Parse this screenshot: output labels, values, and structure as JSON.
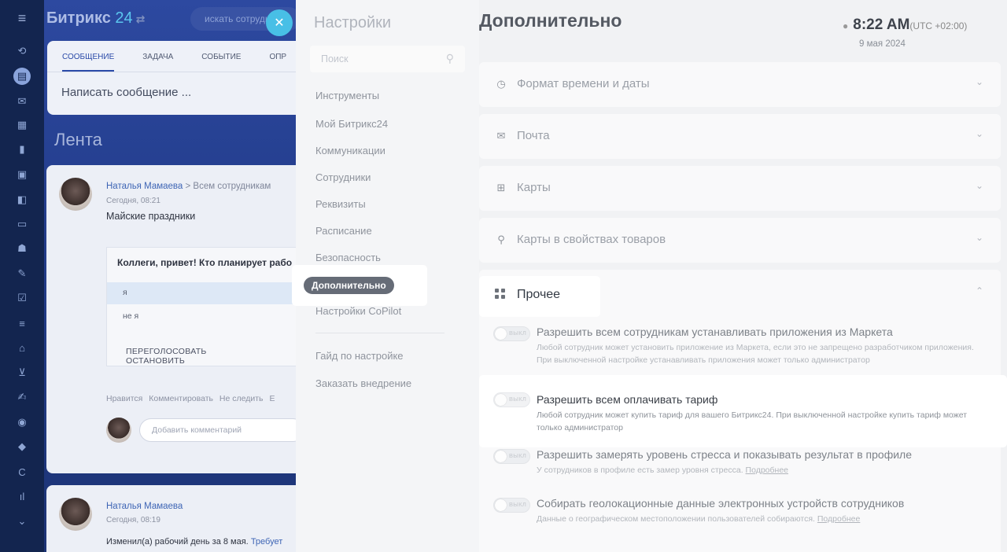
{
  "leftbar": {
    "icons": [
      "menu-icon",
      "feed-icon",
      "chat-icon",
      "mail-icon",
      "calendar-icon",
      "document-icon",
      "contacts-icon",
      "messenger-icon",
      "storage-icon",
      "team-icon",
      "tasks-icon",
      "checklist-icon",
      "filter-icon",
      "store-icon",
      "cart-icon",
      "sign-icon",
      "robot-icon",
      "box-icon",
      "copilot-icon",
      "analytics-icon",
      "more-icon"
    ]
  },
  "bg": {
    "logo": "Битрикс",
    "logo_num": "24",
    "search_placeholder": "искать сотрудн",
    "composer_tabs": [
      "СООБЩЕНИЕ",
      "ЗАДАЧА",
      "СОБЫТИЕ",
      "ОПР"
    ],
    "composer_placeholder": "Написать сообщение ...",
    "feed_title": "Лента",
    "post1": {
      "author": "Наталья Мамаева",
      "to": "> Всем сотрудникам",
      "time": "Сегодня, 08:21",
      "title": "Майские праздники",
      "question": "Коллеги, привет!  Кто планирует рабо",
      "options": [
        "я",
        "не я"
      ],
      "vote_buttons": [
        "ПЕРЕГОЛОСОВАТЬ",
        "ОСТАНОВИТЬ"
      ],
      "actions": [
        "Нравится",
        "Комментировать",
        "Не следить",
        "Е"
      ],
      "comment_placeholder": "Добавить комментарий"
    },
    "post2": {
      "author": "Наталья Мамаева",
      "time": "Сегодня, 08:19",
      "text": "Изменил(а) рабочий день за 8 мая.",
      "link": "Требует"
    }
  },
  "menu": {
    "title": "Настройки",
    "search_placeholder": "Поиск",
    "items": [
      "Инструменты",
      "Мой Битрикс24",
      "Коммуникации",
      "Сотрудники",
      "Реквизиты",
      "Расписание",
      "Безопасность",
      "Дополнительно",
      "Настройки CoPilot"
    ],
    "active": "Дополнительно",
    "extra_items": [
      "Гайд по настройке",
      "Заказать внедрение"
    ]
  },
  "main": {
    "title": "Дополнительно",
    "time": "8:22 AM",
    "timezone": "(UTC +02:00)",
    "date": "9 мая 2024",
    "sections": [
      {
        "label": "Формат времени и даты",
        "icon": "clock-icon"
      },
      {
        "label": "Почта",
        "icon": "mail-icon"
      },
      {
        "label": "Карты",
        "icon": "map-icon"
      },
      {
        "label": "Карты в свойствах товаров",
        "icon": "location-pin-icon"
      }
    ],
    "open_section": {
      "label": "Прочее",
      "icon": "apps-grid-icon"
    },
    "toggle_off_text": "ВЫКЛ",
    "options": [
      {
        "title": "Разрешить всем сотрудникам устанавливать приложения из Маркета",
        "desc": "Любой сотрудник может установить приложение из Маркета, если это не запрещено разработчиком приложения. При выключенной настройке устанавливать приложения может только администратор",
        "link": ""
      },
      {
        "title": "Разрешить всем оплачивать тариф",
        "desc": "Любой сотрудник может купить тариф для вашего Битрикс24. При выключенной настройке купить тариф может только администратор",
        "link": ""
      },
      {
        "title": "Разрешить замерять уровень стресса и показывать результат в профиле",
        "desc": "У сотрудников в профиле есть замер уровня стресса.",
        "link": "Подробнее"
      },
      {
        "title": "Собирать геолокационные данные электронных устройств сотрудников",
        "desc": "Данные о географическом местоположении пользователей собираются.",
        "link": "Подробнее"
      }
    ]
  },
  "colors": {
    "accent": "#2fc6f6",
    "sidebar": "#13254f",
    "highlight": "#ffffff"
  }
}
